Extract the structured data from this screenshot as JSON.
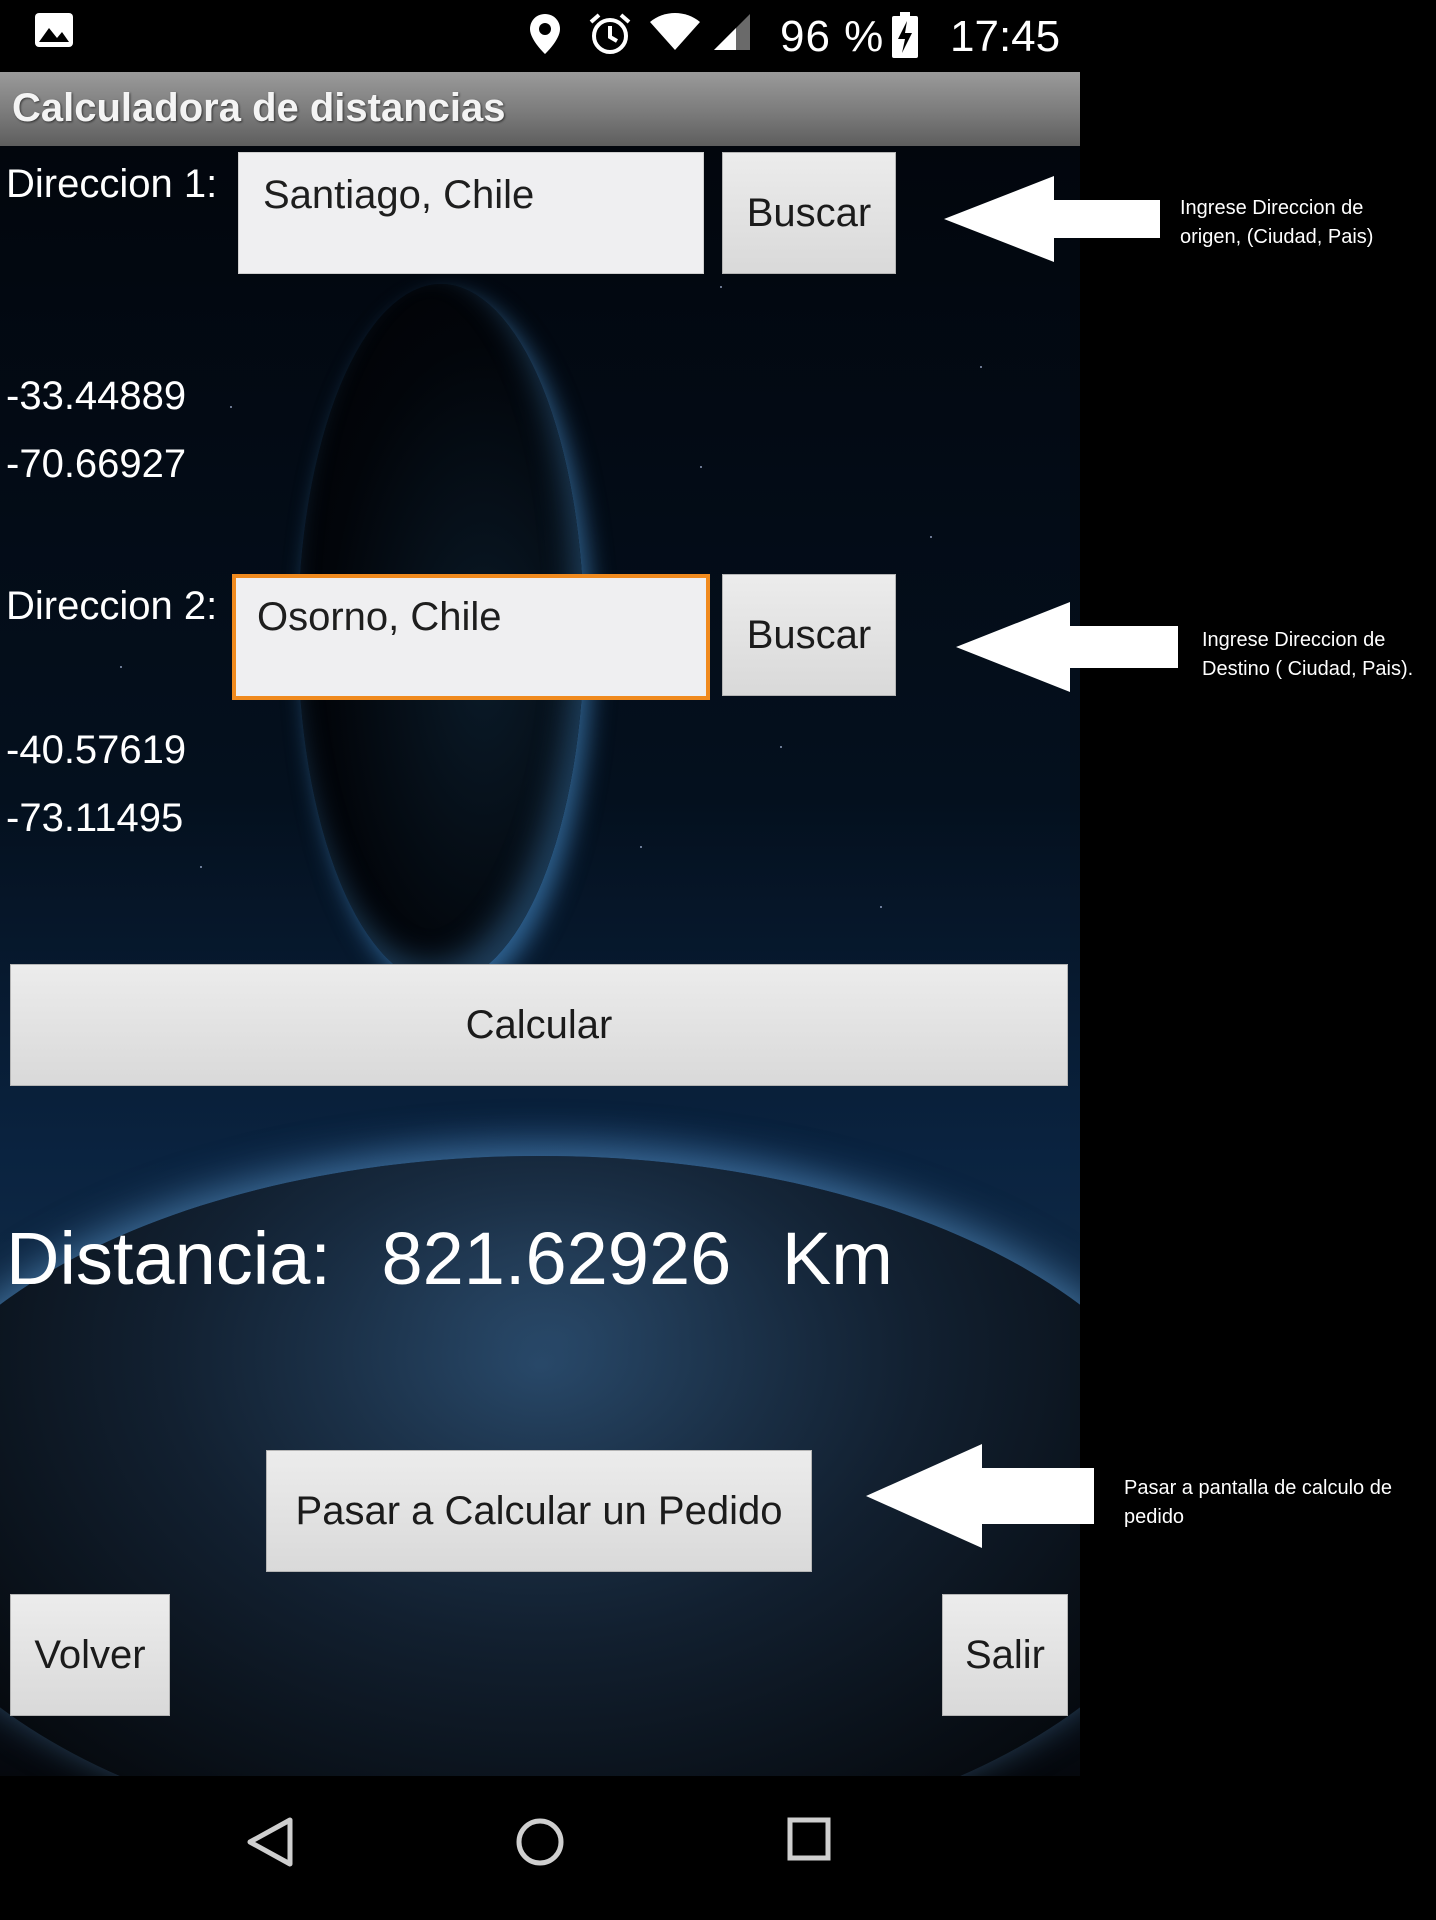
{
  "status_bar": {
    "battery_percent": "96 %",
    "time": "17:45",
    "icons": [
      "image-icon",
      "location-icon",
      "alarm-icon",
      "wifi-icon",
      "signal-icon",
      "battery-charging-icon"
    ]
  },
  "app_bar": {
    "title": "Calculadora de distancias"
  },
  "address1": {
    "label": "Direccion 1:",
    "value": "Santiago, Chile",
    "button": "Buscar",
    "lat": "-33.44889",
    "lng": "-70.66927"
  },
  "address2": {
    "label": "Direccion 2:",
    "value": "Osorno, Chile",
    "button": "Buscar",
    "lat": "-40.57619",
    "lng": "-73.11495"
  },
  "calculate_button": "Calcular",
  "result": {
    "label": "Distancia:",
    "value": "821.62926",
    "unit": "Km"
  },
  "order_button": "Pasar a Calcular un Pedido",
  "back_button": "Volver",
  "exit_button": "Salir",
  "annotations": {
    "origin_line1": "Ingrese Direccion de",
    "origin_line2": "origen, (Ciudad, Pais)",
    "dest_line1": "Ingrese Direccion de",
    "dest_line2": "Destino ( Ciudad, Pais).",
    "order_line1": "Pasar a pantalla de calculo de",
    "order_line2": "pedido"
  },
  "colors": {
    "focus_border": "#f08a1e",
    "app_bar": "#7b7b7b"
  }
}
